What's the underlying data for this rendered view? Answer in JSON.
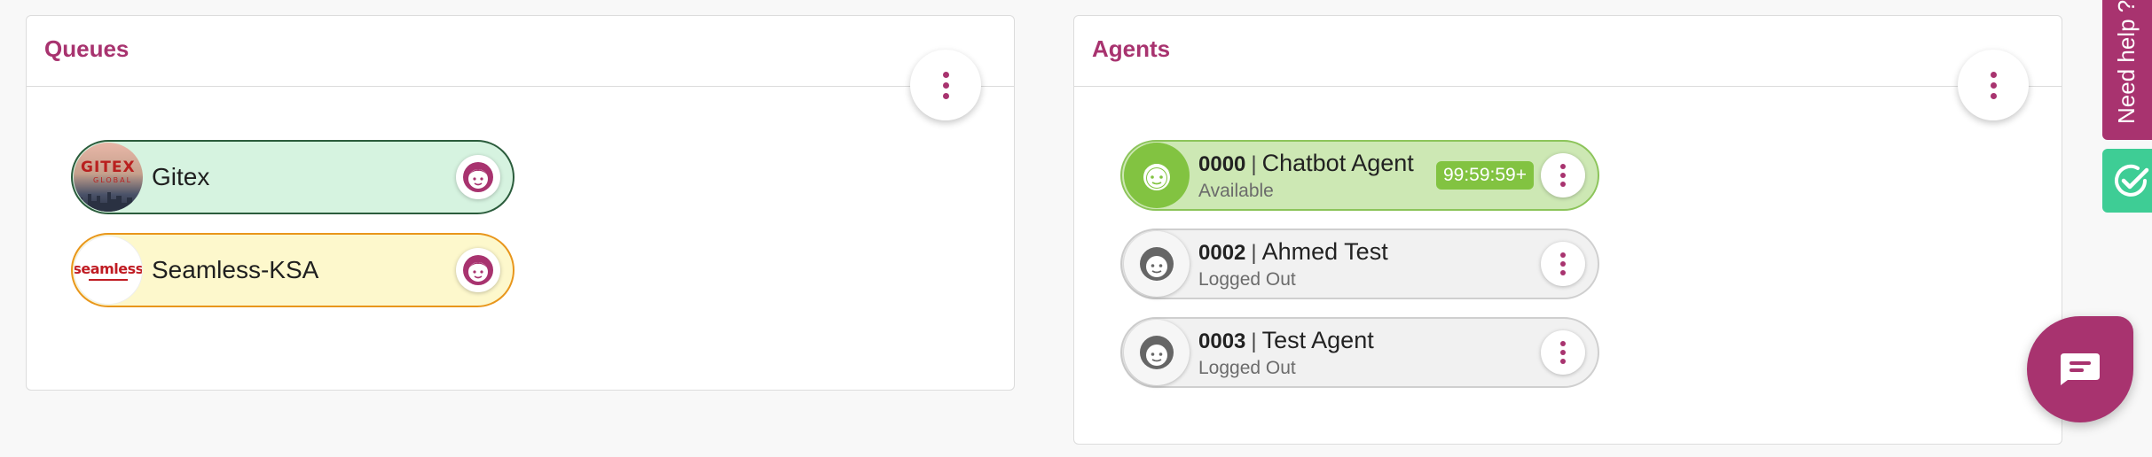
{
  "colors": {
    "brand": "#a8336f",
    "available": "#82c341",
    "check_widget": "#3ecd95"
  },
  "queues_panel": {
    "title": "Queues",
    "menu_icon": "kebab-vertical-icon",
    "items": [
      {
        "name": "Gitex",
        "logo_text": "GITEX",
        "logo_subtext": "GLOBAL",
        "icon": "agent-face-icon"
      },
      {
        "name": "Seamless-KSA",
        "logo_text": "seamless",
        "icon": "agent-face-icon"
      }
    ]
  },
  "agents_panel": {
    "title": "Agents",
    "menu_icon": "kebab-vertical-icon",
    "items": [
      {
        "id": "0000",
        "separator": "|",
        "name": "Chatbot Agent",
        "status": "Available",
        "timer": "99:59:59+"
      },
      {
        "id": "0002",
        "separator": "|",
        "name": "Ahmed Test",
        "status": "Logged Out"
      },
      {
        "id": "0003",
        "separator": "|",
        "name": "Test Agent",
        "status": "Logged Out"
      }
    ]
  },
  "help_widget": {
    "label": "Need help ?"
  },
  "check_widget": {
    "icon": "check-circle-icon"
  },
  "chat_button": {
    "icon": "chat-bubble-icon"
  }
}
